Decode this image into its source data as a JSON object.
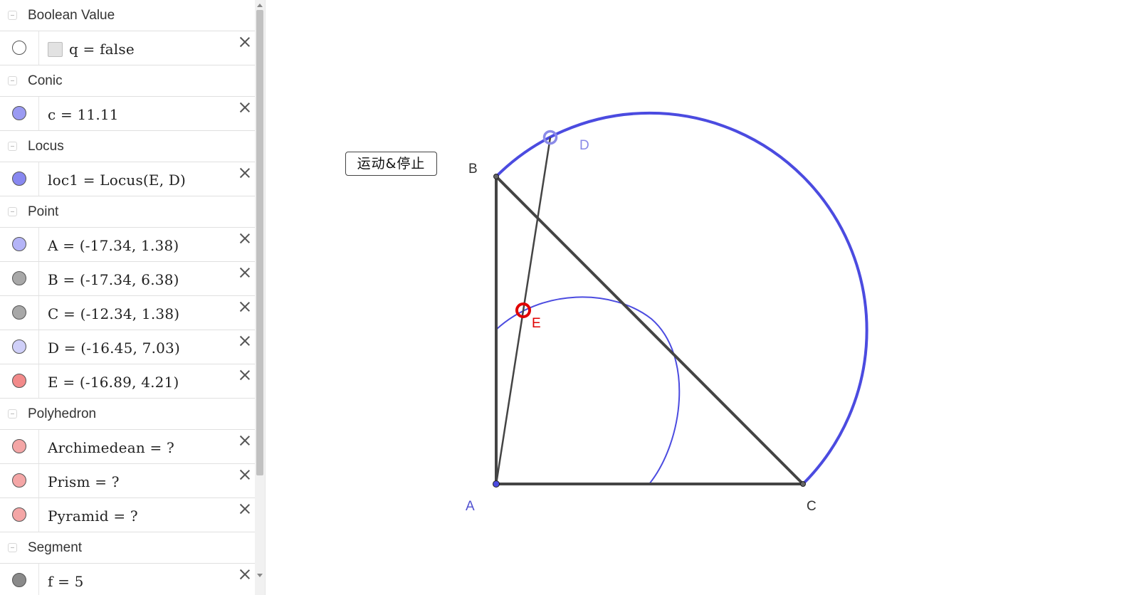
{
  "algebra_view": {
    "categories": [
      {
        "label": "Boolean Value"
      },
      {
        "label": "Conic"
      },
      {
        "label": "Locus"
      },
      {
        "label": "Point"
      },
      {
        "label": "Polyhedron"
      },
      {
        "label": "Segment"
      }
    ],
    "rows": {
      "q": {
        "text": "q = false",
        "marble_color": "#ffffff"
      },
      "c": {
        "text": "c = 11.11",
        "marble_color": "#9a9af2"
      },
      "loc1": {
        "text": "loc1 = Locus(E, D)",
        "marble_color": "#8888f0"
      },
      "A": {
        "text": "A = (-17.34, 1.38)",
        "marble_color": "#b4b4f7"
      },
      "B": {
        "text": "B = (-17.34, 6.38)",
        "marble_color": "#a8a8a8"
      },
      "C": {
        "text": "C = (-12.34, 1.38)",
        "marble_color": "#a8a8a8"
      },
      "D": {
        "text": "D = (-16.45, 7.03)",
        "marble_color": "#cfcff8"
      },
      "E": {
        "text": "E = (-16.89, 4.21)",
        "marble_color": "#f28a8a"
      },
      "archimedean": {
        "text": "Archimedean = ?",
        "marble_color": "#f4a6a6"
      },
      "prism": {
        "text": "Prism = ?",
        "marble_color": "#f4a6a6"
      },
      "pyramid": {
        "text": "Pyramid = ?",
        "marble_color": "#f4a6a6"
      },
      "f": {
        "text": "f = 5",
        "marble_color": "#8a8a8a"
      }
    }
  },
  "graphics_view": {
    "button_label": "运动&停止",
    "point_labels": {
      "A": "A",
      "B": "B",
      "C": "C",
      "D": "D",
      "E": "E"
    },
    "colors": {
      "segment": "#444444",
      "conic": "#4b4be0",
      "point_D": "#8a8ae8",
      "point_E": "#e00000",
      "label_blue": "#5050d0",
      "label_red": "#e00000"
    }
  }
}
